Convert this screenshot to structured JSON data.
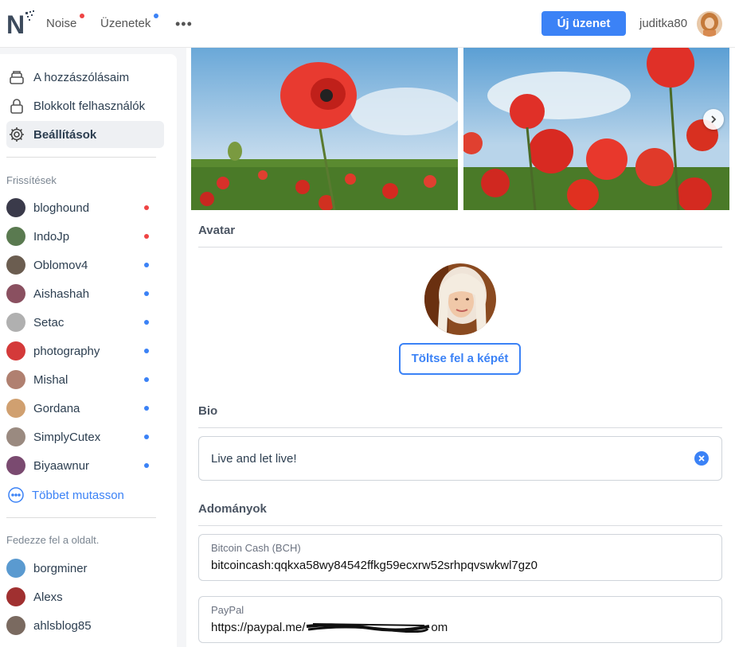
{
  "header": {
    "nav": [
      {
        "label": "Noise",
        "dot_color": "#ef4444"
      },
      {
        "label": "Üzenetek",
        "dot_color": "#3b82f6"
      }
    ],
    "more": "•••",
    "new_message": "Új üzenet",
    "username": "juditka80"
  },
  "sidebar": {
    "menu": [
      {
        "label": "A hozzászólásaim",
        "icon": "stack-icon"
      },
      {
        "label": "Blokkolt felhasználók",
        "icon": "lock-icon"
      },
      {
        "label": "Beállítások",
        "icon": "gear-icon",
        "active": true
      }
    ],
    "updates_label": "Frissítések",
    "updates": [
      {
        "name": "bloghound",
        "dot": "#ef4444",
        "avatar_color": "#3a3a4a"
      },
      {
        "name": "IndoJp",
        "dot": "#ef4444",
        "avatar_color": "#5a7a50"
      },
      {
        "name": "Oblomov4",
        "dot": "#3b82f6",
        "avatar_color": "#6b5d50"
      },
      {
        "name": "Aishashah",
        "dot": "#3b82f6",
        "avatar_color": "#8a5060"
      },
      {
        "name": "Setac",
        "dot": "#3b82f6",
        "avatar_color": "#b0b0b0"
      },
      {
        "name": "photography",
        "dot": "#3b82f6",
        "avatar_color": "#d43a3a"
      },
      {
        "name": "Mishal",
        "dot": "#3b82f6",
        "avatar_color": "#b08070"
      },
      {
        "name": "Gordana",
        "dot": "#3b82f6",
        "avatar_color": "#d0a070"
      },
      {
        "name": "SimplyCutex",
        "dot": "#3b82f6",
        "avatar_color": "#9a8a80"
      },
      {
        "name": "Biyaawnur",
        "dot": "#3b82f6",
        "avatar_color": "#7a4a70"
      }
    ],
    "show_more": "Többet mutasson",
    "discover_label": "Fedezze fel a oldalt.",
    "discover": [
      {
        "name": "borgminer",
        "avatar_color": "#5a9ad0"
      },
      {
        "name": "Alexs",
        "avatar_color": "#a03030"
      },
      {
        "name": "ahlsblog85",
        "avatar_color": "#7a6a60"
      }
    ]
  },
  "main": {
    "avatar_title": "Avatar",
    "upload_button": "Töltse fel a képét",
    "bio_title": "Bio",
    "bio_value": "Live and let live!",
    "donations_title": "Adományok",
    "bch_label": "Bitcoin Cash (BCH)",
    "bch_value": "bitcoincash:qqkxa58wy84542ffkg59ecxrw52srhpqvswkwl7gz0",
    "paypal_label": "PayPal",
    "paypal_value": "https://paypal.me/",
    "paypal_value_suffix": "om"
  },
  "colors": {
    "accent": "#3b82f6",
    "notify_red": "#ef4444"
  }
}
